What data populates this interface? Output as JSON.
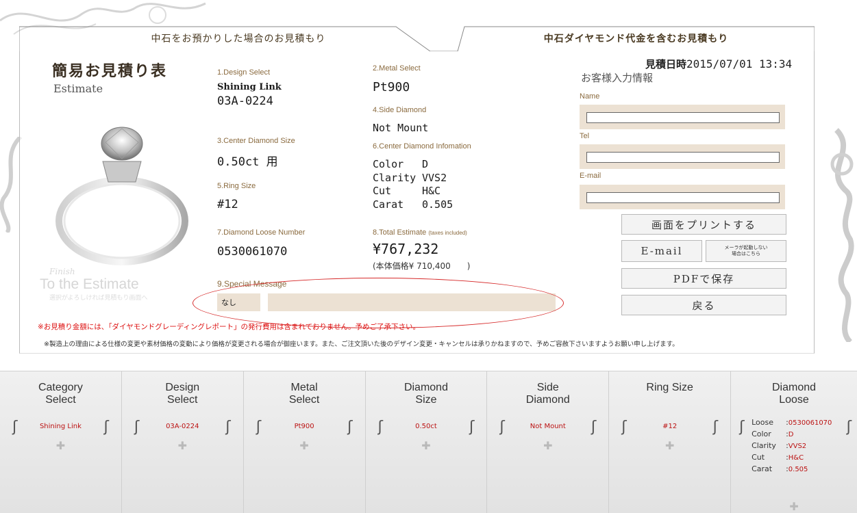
{
  "tabs": {
    "left": "中石をお預かりした場合のお見積もり",
    "right": "中石ダイヤモンド代金を含むお見積もり"
  },
  "header": {
    "title_jp": "簡易お見積り表",
    "title_en": "Estimate"
  },
  "finish": {
    "small": "Finish",
    "big": "To the Estimate",
    "note": "選択がよろしければ見積もり画面へ"
  },
  "fields": {
    "design_label": "1.Design Select",
    "design_name": "Shining Link",
    "design_code": "03A-0224",
    "center_size_label": "3.Center Diamond Size",
    "center_size": "0.50ct 用",
    "ring_size_label": "5.Ring Size",
    "ring_size": "#12",
    "loose_label": "7.Diamond Loose Number",
    "loose_number": "0530061070",
    "metal_label": "2.Metal Select",
    "metal": "Pt900",
    "side_label": "4.Side Diamond",
    "side": "Not Mount",
    "info_label": "6.Center Diamond Infomation",
    "info": [
      {
        "k": "Color",
        "v": "D"
      },
      {
        "k": "Clarity",
        "v": "VVS2"
      },
      {
        "k": "Cut",
        "v": "H&C"
      },
      {
        "k": "Carat",
        "v": "0.505"
      }
    ],
    "total_label": "8.Total Estimate",
    "total_tax": "(taxes included)",
    "total": "¥767,232",
    "body_price": "(本体価格¥ 710,400　　)",
    "special_label": "9.Special Message",
    "special_value": "なし"
  },
  "notices": {
    "red": "※お見積り金額には、「ダイヤモンドグレーディングレポート」の発行費用は含まれておりません。予めご了承下さい。",
    "gray": "※製造上の理由による仕様の変更や素材価格の変動により価格が変更される場合が御座います。また、ご注文頂いた後のデザイン変更・キャンセルは承りかねますので、予めご容赦下さいますようお願い申し上げます。"
  },
  "customer": {
    "date_label": "見積日時",
    "date": "2015/07/01 13:34",
    "title": "お客様入力情報",
    "name_label": "Name",
    "tel_label": "Tel",
    "email_label": "E-mail",
    "name_value": "",
    "tel_value": "",
    "email_value": ""
  },
  "buttons": {
    "print": "画面をプリントする",
    "email": "E-mail",
    "mailer_note_1": "メーラが起動しない",
    "mailer_note_2": "場合はこちら",
    "pdf": "PDFで保存",
    "back": "戻る"
  },
  "bottom": {
    "columns": [
      {
        "title1": "Category",
        "title2": "Select",
        "value": "Shining Link"
      },
      {
        "title1": "Design",
        "title2": "Select",
        "value": "03A-0224"
      },
      {
        "title1": "Metal",
        "title2": "Select",
        "value": "Pt900"
      },
      {
        "title1": "Diamond",
        "title2": "Size",
        "value": "0.50ct"
      },
      {
        "title1": "Side",
        "title2": "Diamond",
        "value": "Not Mount"
      },
      {
        "title1": "Ring Size",
        "title2": "",
        "value": "#12"
      }
    ],
    "loose": {
      "title1": "Diamond",
      "title2": "Loose",
      "rows": [
        {
          "k": "Loose",
          "v": "0530061070"
        },
        {
          "k": "Color",
          "v": "D"
        },
        {
          "k": "Clarity",
          "v": "VVS2"
        },
        {
          "k": "Cut",
          "v": "H&C"
        },
        {
          "k": "Carat",
          "v": "0.505"
        }
      ]
    }
  },
  "icons": {
    "scroll_left": "scroll-left-icon",
    "scroll_right": "scroll-right-icon",
    "plus": "plus-icon"
  },
  "colors": {
    "accent_brown": "#8a6a3e",
    "field_bg": "#ece1d3",
    "alert_red": "#d11111"
  }
}
